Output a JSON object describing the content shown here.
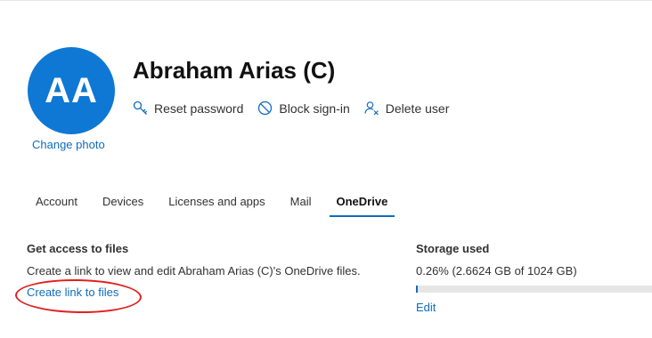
{
  "user": {
    "initials": "AA",
    "name": "Abraham Arias (C)",
    "change_photo_label": "Change photo"
  },
  "actions": [
    {
      "label": "Reset password",
      "icon": "key-icon"
    },
    {
      "label": "Block sign-in",
      "icon": "block-icon"
    },
    {
      "label": "Delete user",
      "icon": "delete-user-icon"
    }
  ],
  "tabs": [
    {
      "label": "Account",
      "active": false
    },
    {
      "label": "Devices",
      "active": false
    },
    {
      "label": "Licenses and apps",
      "active": false
    },
    {
      "label": "Mail",
      "active": false
    },
    {
      "label": "OneDrive",
      "active": true
    }
  ],
  "files": {
    "title": "Get access to files",
    "description": "Create a link to view and edit Abraham Arias (C)'s OneDrive files.",
    "link_label": "Create link to files"
  },
  "storage": {
    "title": "Storage used",
    "usage_text": "0.26% (2.6624 GB of 1024 GB)",
    "used_percent": 0.26,
    "edit_label": "Edit"
  },
  "colors": {
    "avatar": "#0f78d4",
    "link": "#0f6cbd",
    "annotation": "#e02020"
  }
}
